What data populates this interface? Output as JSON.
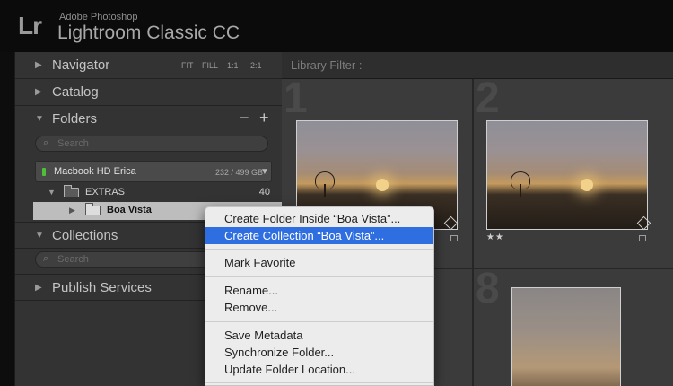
{
  "brand": {
    "logo": "Lr",
    "vendor": "Adobe Photoshop",
    "product": "Lightroom Classic CC"
  },
  "left_panel": {
    "navigator": {
      "title": "Navigator",
      "options": [
        "FIT",
        "FILL",
        "1:1",
        "2:1"
      ]
    },
    "catalog": {
      "title": "Catalog"
    },
    "folders": {
      "title": "Folders",
      "minus": "−",
      "plus": "+",
      "search_placeholder": "Search",
      "drive": {
        "name": "Macbook HD Erica",
        "size": "232 / 499 GB"
      },
      "rows": [
        {
          "label": "EXTRAS",
          "count": "40"
        },
        {
          "label": "Boa Vista",
          "count": ""
        }
      ]
    },
    "collections": {
      "title": "Collections",
      "search_placeholder": "Search"
    },
    "publish": {
      "title": "Publish Services"
    }
  },
  "library": {
    "filter_label": "Library Filter :",
    "cells": [
      {
        "number": "1",
        "stars": ""
      },
      {
        "number": "2",
        "stars": "★★"
      },
      {
        "number": "8",
        "stars": ""
      }
    ]
  },
  "context_menu": {
    "items": [
      "Create Folder Inside “Boa Vista”...",
      "Create Collection “Boa Vista”...",
      "Mark Favorite",
      "Rename...",
      "Remove...",
      "Save Metadata",
      "Synchronize Folder...",
      "Update Folder Location..."
    ],
    "highlighted_index": 1
  },
  "colors": {
    "accent": "#2f6ee0",
    "panel": "#333333",
    "drive_led": "#4fbf3a"
  }
}
